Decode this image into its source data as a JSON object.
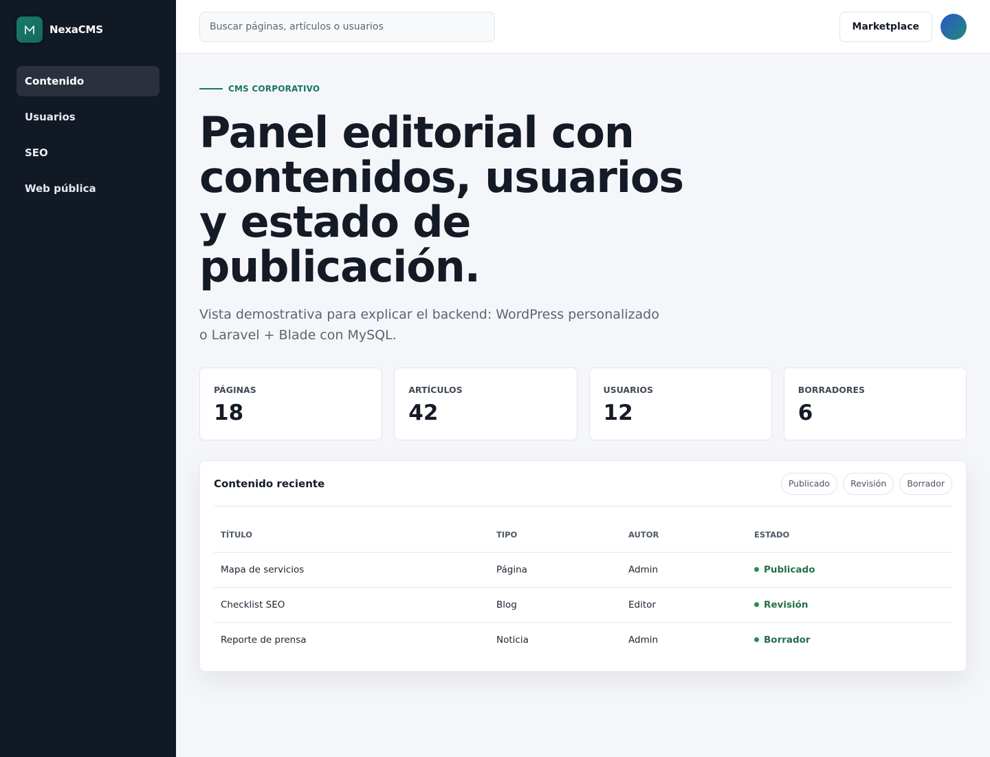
{
  "brand": {
    "logo_letter": "M",
    "name": "NexaCMS"
  },
  "sidebar": {
    "items": [
      {
        "label": "Contenido",
        "active": true
      },
      {
        "label": "Usuarios",
        "active": false
      },
      {
        "label": "SEO",
        "active": false
      },
      {
        "label": "Web pública",
        "active": false
      }
    ]
  },
  "topbar": {
    "search_placeholder": "Buscar páginas, artículos o usuarios",
    "marketplace_label": "Marketplace"
  },
  "hero": {
    "eyebrow": "CMS CORPORATIVO",
    "title": "Panel editorial con contenidos, usuarios y estado de publicación.",
    "subtitle": "Vista demostrativa para explicar el backend: WordPress personalizado o Laravel + Blade con MySQL."
  },
  "stats": [
    {
      "label": "PÁGINAS",
      "value": "18"
    },
    {
      "label": "ARTÍCULOS",
      "value": "42"
    },
    {
      "label": "USUARIOS",
      "value": "12"
    },
    {
      "label": "BORRADORES",
      "value": "6"
    }
  ],
  "recent": {
    "title": "Contenido reciente",
    "filters": [
      "Publicado",
      "Revisión",
      "Borrador"
    ],
    "columns": [
      "TÍTULO",
      "TIPO",
      "AUTOR",
      "ESTADO"
    ],
    "rows": [
      {
        "title": "Mapa de servicios",
        "type": "Página",
        "author": "Admin",
        "status": "Publicado"
      },
      {
        "title": "Checklist SEO",
        "type": "Blog",
        "author": "Editor",
        "status": "Revisión"
      },
      {
        "title": "Reporte de prensa",
        "type": "Noticia",
        "author": "Admin",
        "status": "Borrador"
      }
    ]
  },
  "colors": {
    "sidebar_bg": "#111925",
    "accent": "#167766",
    "status_green": "#227049"
  },
  "icons": {
    "logo": "m-letter-icon"
  }
}
